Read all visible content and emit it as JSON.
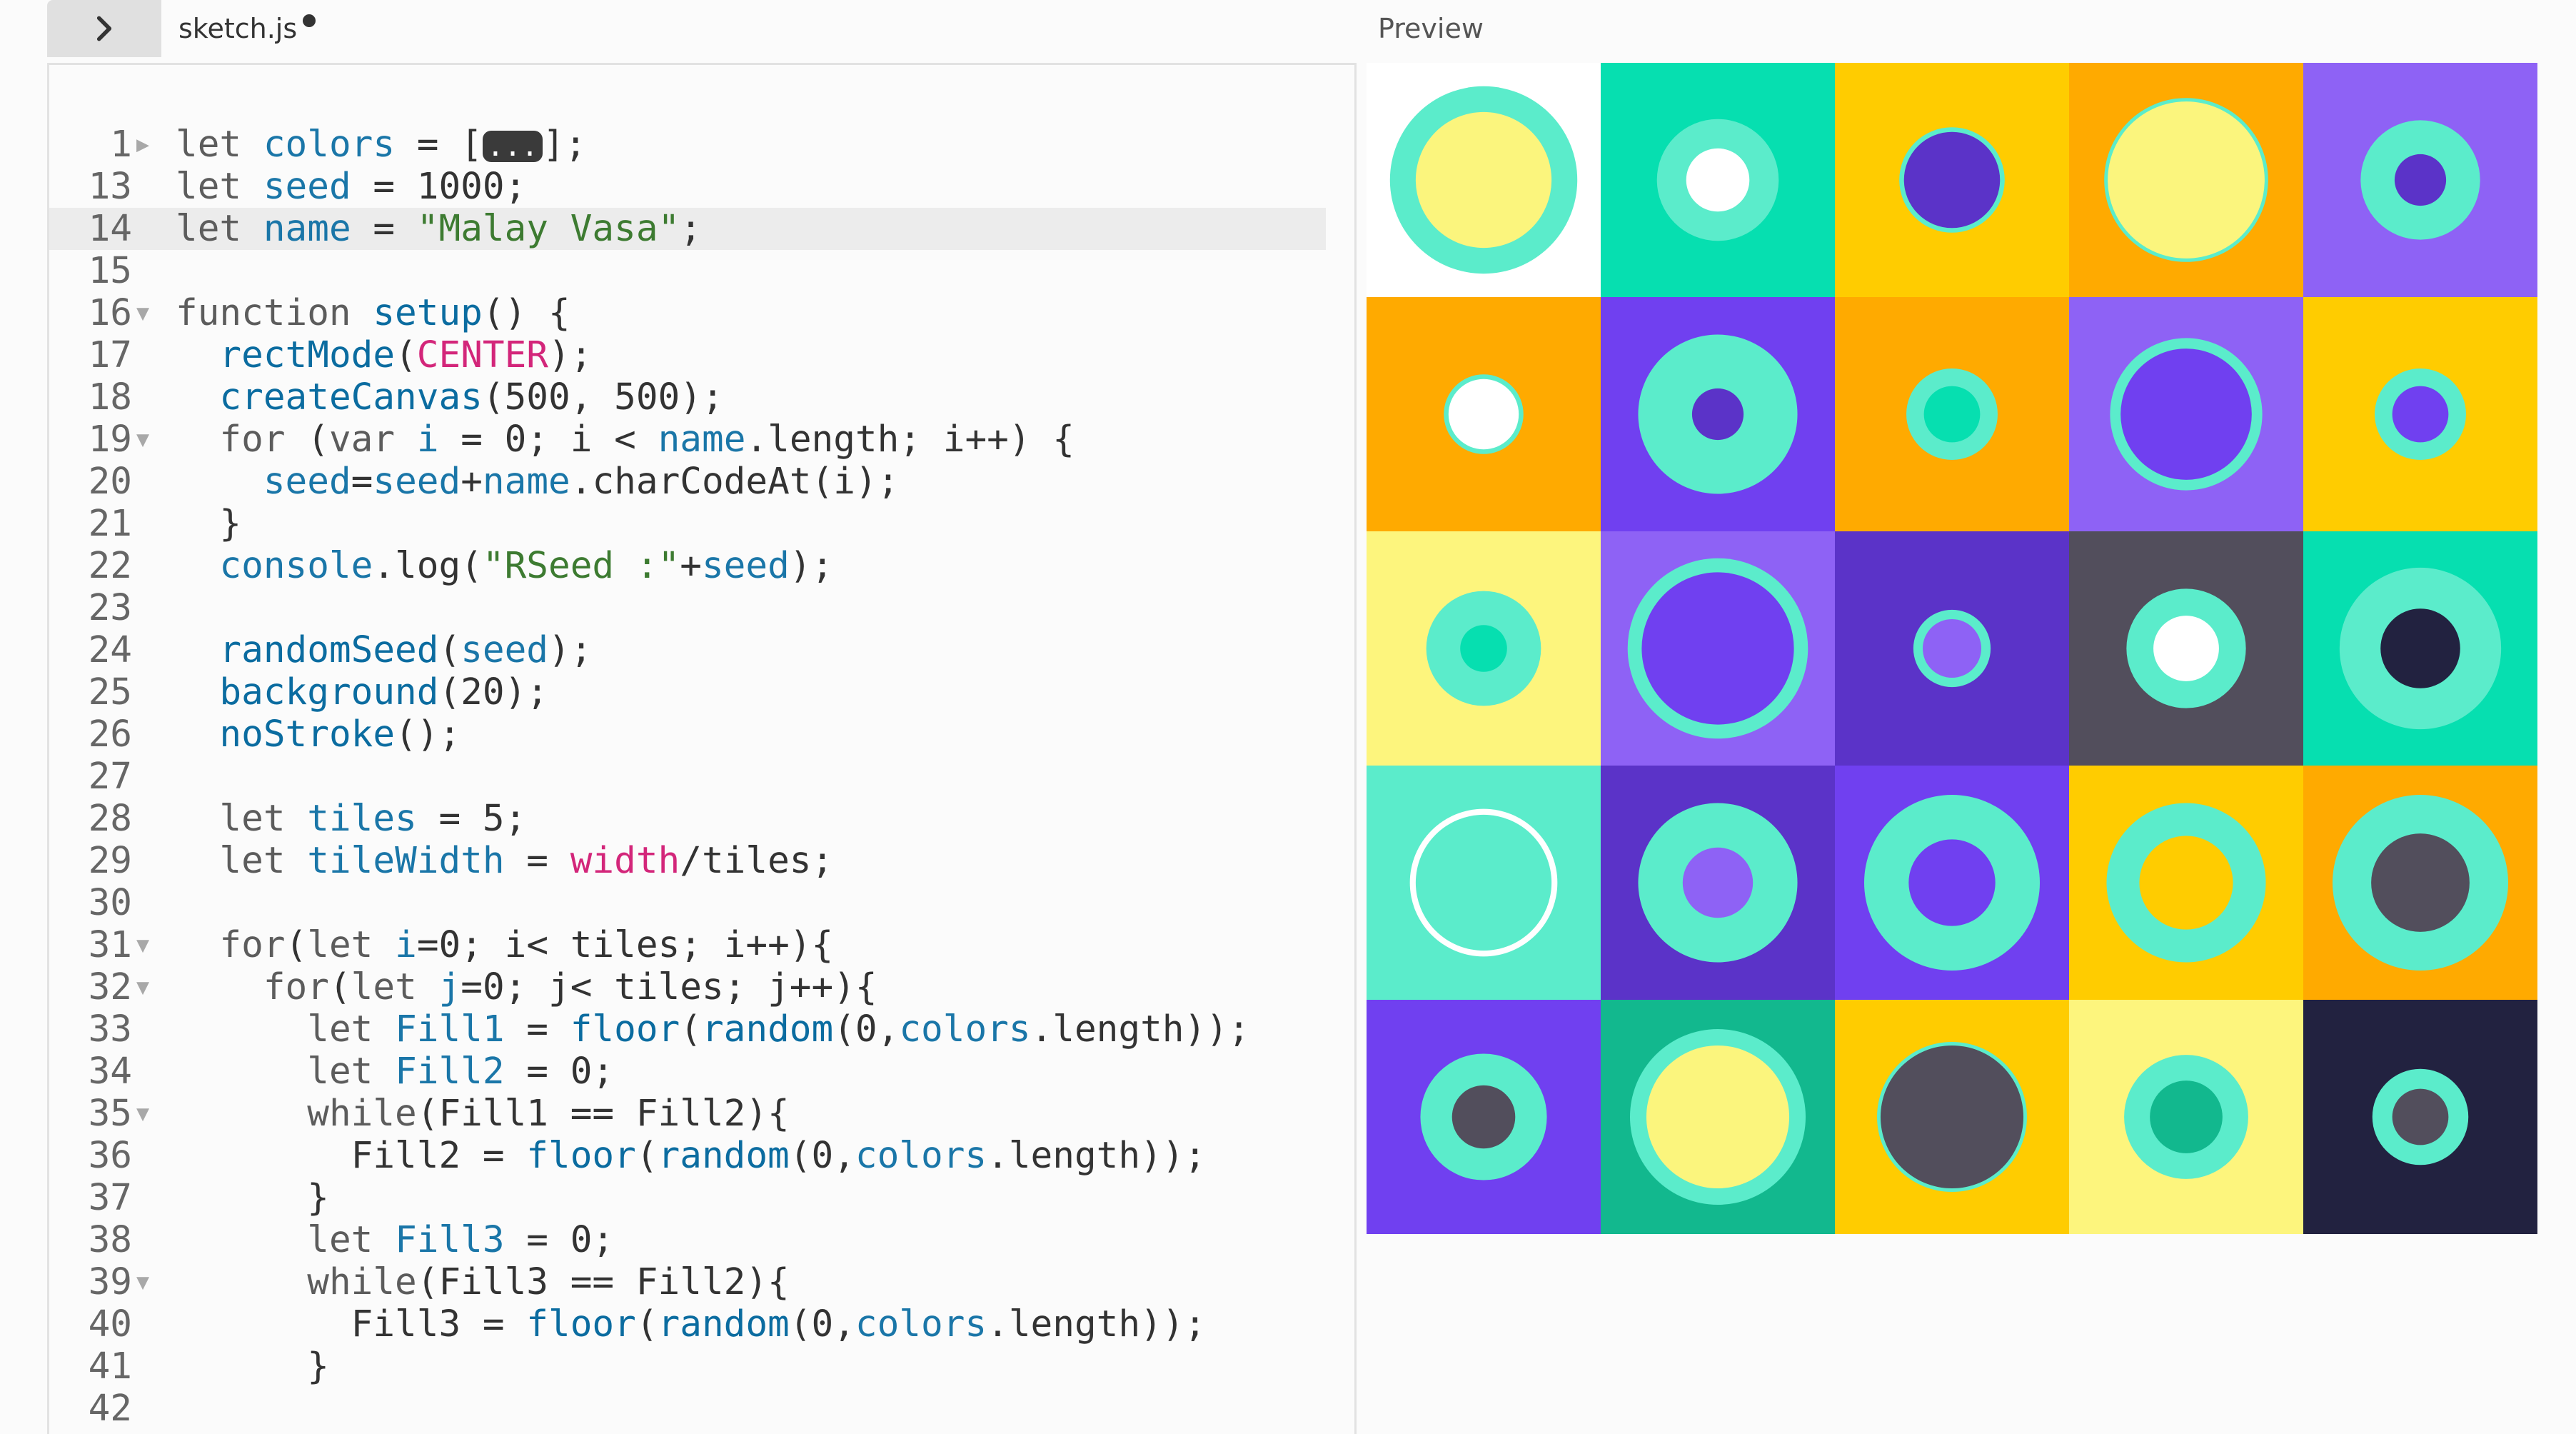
{
  "header": {
    "file_name": "sketch.js",
    "preview_label": "Preview"
  },
  "editor": {
    "lines": [
      {
        "num": "1",
        "fold": "▶",
        "tokens": [
          [
            "kw",
            "let "
          ],
          [
            "var",
            "colors"
          ],
          [
            "plain",
            " = ["
          ],
          [
            "pill",
            "..."
          ],
          [
            "plain",
            "];"
          ]
        ]
      },
      {
        "num": "13",
        "tokens": [
          [
            "kw",
            "let "
          ],
          [
            "var",
            "seed"
          ],
          [
            "plain",
            " = 1000;"
          ]
        ]
      },
      {
        "num": "14",
        "active": true,
        "tokens": [
          [
            "kw",
            "let "
          ],
          [
            "var",
            "name"
          ],
          [
            "plain",
            " = "
          ],
          [
            "str",
            "\"Malay Vasa\""
          ],
          [
            "plain",
            ";"
          ]
        ]
      },
      {
        "num": "15",
        "tokens": []
      },
      {
        "num": "16",
        "fold": "▼",
        "tokens": [
          [
            "kw",
            "function "
          ],
          [
            "fn",
            "setup"
          ],
          [
            "plain",
            "() {"
          ]
        ]
      },
      {
        "num": "17",
        "tokens": [
          [
            "plain",
            "  "
          ],
          [
            "fn",
            "rectMode"
          ],
          [
            "plain",
            "("
          ],
          [
            "const",
            "CENTER"
          ],
          [
            "plain",
            ");"
          ]
        ]
      },
      {
        "num": "18",
        "tokens": [
          [
            "plain",
            "  "
          ],
          [
            "fn",
            "createCanvas"
          ],
          [
            "plain",
            "(500, 500);"
          ]
        ]
      },
      {
        "num": "19",
        "fold": "▼",
        "tokens": [
          [
            "plain",
            "  "
          ],
          [
            "kw",
            "for"
          ],
          [
            "plain",
            " ("
          ],
          [
            "kw",
            "var"
          ],
          [
            "plain",
            " "
          ],
          [
            "var",
            "i"
          ],
          [
            "plain",
            " = 0; i < "
          ],
          [
            "var",
            "name"
          ],
          [
            "plain",
            ".length; i++) {"
          ]
        ]
      },
      {
        "num": "20",
        "tokens": [
          [
            "plain",
            "    "
          ],
          [
            "var",
            "seed"
          ],
          [
            "plain",
            "="
          ],
          [
            "var",
            "seed"
          ],
          [
            "plain",
            "+"
          ],
          [
            "var",
            "name"
          ],
          [
            "plain",
            ".charCodeAt(i);"
          ]
        ]
      },
      {
        "num": "21",
        "tokens": [
          [
            "plain",
            "  }"
          ]
        ]
      },
      {
        "num": "22",
        "tokens": [
          [
            "plain",
            "  "
          ],
          [
            "var",
            "console"
          ],
          [
            "plain",
            ".log("
          ],
          [
            "str",
            "\"RSeed :\""
          ],
          [
            "plain",
            "+"
          ],
          [
            "var",
            "seed"
          ],
          [
            "plain",
            ");"
          ]
        ]
      },
      {
        "num": "23",
        "tokens": []
      },
      {
        "num": "24",
        "tokens": [
          [
            "plain",
            "  "
          ],
          [
            "fn",
            "randomSeed"
          ],
          [
            "plain",
            "("
          ],
          [
            "var",
            "seed"
          ],
          [
            "plain",
            ");"
          ]
        ]
      },
      {
        "num": "25",
        "tokens": [
          [
            "plain",
            "  "
          ],
          [
            "fn",
            "background"
          ],
          [
            "plain",
            "(20);"
          ]
        ]
      },
      {
        "num": "26",
        "tokens": [
          [
            "plain",
            "  "
          ],
          [
            "fn",
            "noStroke"
          ],
          [
            "plain",
            "();"
          ]
        ]
      },
      {
        "num": "27",
        "tokens": []
      },
      {
        "num": "28",
        "tokens": [
          [
            "plain",
            "  "
          ],
          [
            "kw",
            "let "
          ],
          [
            "var",
            "tiles"
          ],
          [
            "plain",
            " = 5;"
          ]
        ]
      },
      {
        "num": "29",
        "tokens": [
          [
            "plain",
            "  "
          ],
          [
            "kw",
            "let "
          ],
          [
            "var",
            "tileWidth"
          ],
          [
            "plain",
            " = "
          ],
          [
            "const",
            "width"
          ],
          [
            "plain",
            "/tiles;"
          ]
        ]
      },
      {
        "num": "30",
        "tokens": []
      },
      {
        "num": "31",
        "fold": "▼",
        "tokens": [
          [
            "plain",
            "  "
          ],
          [
            "kw",
            "for"
          ],
          [
            "plain",
            "("
          ],
          [
            "kw",
            "let"
          ],
          [
            "plain",
            " "
          ],
          [
            "var",
            "i"
          ],
          [
            "plain",
            "=0; i< tiles; i++){"
          ]
        ]
      },
      {
        "num": "32",
        "fold": "▼",
        "tokens": [
          [
            "plain",
            "    "
          ],
          [
            "kw",
            "for"
          ],
          [
            "plain",
            "("
          ],
          [
            "kw",
            "let"
          ],
          [
            "plain",
            " "
          ],
          [
            "var",
            "j"
          ],
          [
            "plain",
            "=0; j< tiles; j++){"
          ]
        ]
      },
      {
        "num": "33",
        "tokens": [
          [
            "plain",
            "      "
          ],
          [
            "kw",
            "let "
          ],
          [
            "var",
            "Fill1"
          ],
          [
            "plain",
            " = "
          ],
          [
            "fn",
            "floor"
          ],
          [
            "plain",
            "("
          ],
          [
            "fn",
            "random"
          ],
          [
            "plain",
            "(0,"
          ],
          [
            "var",
            "colors"
          ],
          [
            "plain",
            ".length));"
          ]
        ]
      },
      {
        "num": "34",
        "tokens": [
          [
            "plain",
            "      "
          ],
          [
            "kw",
            "let "
          ],
          [
            "var",
            "Fill2"
          ],
          [
            "plain",
            " = 0;"
          ]
        ]
      },
      {
        "num": "35",
        "fold": "▼",
        "tokens": [
          [
            "plain",
            "      "
          ],
          [
            "kw",
            "while"
          ],
          [
            "plain",
            "(Fill1 == Fill2){"
          ]
        ]
      },
      {
        "num": "36",
        "tokens": [
          [
            "plain",
            "        Fill2 = "
          ],
          [
            "fn",
            "floor"
          ],
          [
            "plain",
            "("
          ],
          [
            "fn",
            "random"
          ],
          [
            "plain",
            "(0,"
          ],
          [
            "var",
            "colors"
          ],
          [
            "plain",
            ".length));"
          ]
        ]
      },
      {
        "num": "37",
        "tokens": [
          [
            "plain",
            "      }"
          ]
        ]
      },
      {
        "num": "38",
        "tokens": [
          [
            "plain",
            "      "
          ],
          [
            "kw",
            "let "
          ],
          [
            "var",
            "Fill3"
          ],
          [
            "plain",
            " = 0;"
          ]
        ]
      },
      {
        "num": "39",
        "fold": "▼",
        "tokens": [
          [
            "plain",
            "      "
          ],
          [
            "kw",
            "while"
          ],
          [
            "plain",
            "(Fill3 == Fill2){"
          ]
        ]
      },
      {
        "num": "40",
        "tokens": [
          [
            "plain",
            "        Fill3 = "
          ],
          [
            "fn",
            "floor"
          ],
          [
            "plain",
            "("
          ],
          [
            "fn",
            "random"
          ],
          [
            "plain",
            "(0,"
          ],
          [
            "var",
            "colors"
          ],
          [
            "plain",
            ".length));"
          ]
        ]
      },
      {
        "num": "41",
        "tokens": [
          [
            "plain",
            "      }"
          ]
        ]
      },
      {
        "num": "42",
        "tokens": []
      }
    ]
  },
  "preview": {
    "tiles": [
      {
        "bg": "#ffffff",
        "outer": "#5beccb",
        "outer_size": 0.8,
        "inner": "#fbf57d",
        "inner_size": 0.58
      },
      {
        "bg": "#06dfb0",
        "outer": "#5beccb",
        "outer_size": 0.52,
        "inner": "#ffffff",
        "inner_size": 0.27
      },
      {
        "bg": "#ffcc00",
        "outer": "#5beccb",
        "outer_size": 0.45,
        "inner": "#5b33c8",
        "inner_size": 0.41
      },
      {
        "bg": "#ffaa00",
        "outer": "#5beccb",
        "outer_size": 0.7,
        "inner": "#fbf57d",
        "inner_size": 0.67
      },
      {
        "bg": "#8e62f5",
        "outer": "#5beccb",
        "outer_size": 0.51,
        "inner": "#5b33c8",
        "inner_size": 0.22
      },
      {
        "bg": "#ffaa00",
        "outer": "#5beccb",
        "outer_size": 0.34,
        "inner": "#ffffff",
        "inner_size": 0.3
      },
      {
        "bg": "#7040f0",
        "outer": "#5beccb",
        "outer_size": 0.68,
        "inner": "#5b33c8",
        "inner_size": 0.22
      },
      {
        "bg": "#ffaa00",
        "outer": "#5beccb",
        "outer_size": 0.39,
        "inner": "#06dfb0",
        "inner_size": 0.24
      },
      {
        "bg": "#8e62f5",
        "outer": "#5beccb",
        "outer_size": 0.65,
        "inner": "#7040f0",
        "inner_size": 0.56
      },
      {
        "bg": "#ffcc00",
        "outer": "#5beccb",
        "outer_size": 0.39,
        "inner": "#7040f0",
        "inner_size": 0.24
      },
      {
        "bg": "#fdf57d",
        "outer": "#5beccb",
        "outer_size": 0.49,
        "inner": "#06dfb0",
        "inner_size": 0.2
      },
      {
        "bg": "#8e62f5",
        "outer": "#5beccb",
        "outer_size": 0.77,
        "inner": "#7040f0",
        "inner_size": 0.65
      },
      {
        "bg": "#5b33c8",
        "outer": "#5beccb",
        "outer_size": 0.33,
        "inner": "#8e62f5",
        "inner_size": 0.25
      },
      {
        "bg": "#524e5c",
        "outer": "#5beccb",
        "outer_size": 0.51,
        "inner": "#ffffff",
        "inner_size": 0.28
      },
      {
        "bg": "#06dfb0",
        "outer": "#5beccb",
        "outer_size": 0.69,
        "inner": "#222240",
        "inner_size": 0.34
      },
      {
        "bg": "#5beccb",
        "outer": "#ffffff",
        "outer_size": 0.63,
        "inner": "#5beccb",
        "inner_size": 0.58
      },
      {
        "bg": "#5b33c8",
        "outer": "#5beccb",
        "outer_size": 0.68,
        "inner": "#8e62f5",
        "inner_size": 0.3
      },
      {
        "bg": "#7040f0",
        "outer": "#5beccb",
        "outer_size": 0.75,
        "inner": "#7040f0",
        "inner_size": 0.37
      },
      {
        "bg": "#ffcc00",
        "outer": "#5beccb",
        "outer_size": 0.68,
        "inner": "#ffcc00",
        "inner_size": 0.4
      },
      {
        "bg": "#ffaa00",
        "outer": "#5beccb",
        "outer_size": 0.75,
        "inner": "#524e5c",
        "inner_size": 0.42
      },
      {
        "bg": "#7040f0",
        "outer": "#5beccb",
        "outer_size": 0.54,
        "inner": "#524e5c",
        "inner_size": 0.27
      },
      {
        "bg": "#12b88e",
        "outer": "#5beccb",
        "outer_size": 0.75,
        "inner": "#fbf57d",
        "inner_size": 0.61
      },
      {
        "bg": "#ffcc00",
        "outer": "#5beccb",
        "outer_size": 0.64,
        "inner": "#524e5c",
        "inner_size": 0.61
      },
      {
        "bg": "#fdf57d",
        "outer": "#5beccb",
        "outer_size": 0.53,
        "inner": "#12b88e",
        "inner_size": 0.31
      },
      {
        "bg": "#222240",
        "outer": "#5beccb",
        "outer_size": 0.41,
        "inner": "#524e5c",
        "inner_size": 0.24
      }
    ]
  },
  "colors": {
    "background": "#fbfbfb",
    "gutter": "#666666",
    "keyword": "#5c5c5c",
    "variable": "#1a76a8",
    "function": "#0b6ca0",
    "string": "#3d7b31",
    "constant": "#d3267a"
  }
}
